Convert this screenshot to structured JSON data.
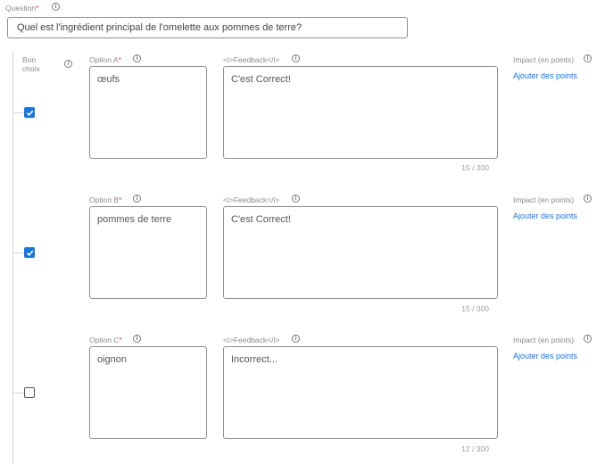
{
  "question": {
    "label": "Question",
    "required_mark": "*",
    "value": "Quel est l'ingrédient principal de l'omelette aux pommes de terre?"
  },
  "good_choice_label_line1": "Bon",
  "good_choice_label_line2": "choix",
  "options": [
    {
      "label": "Option A",
      "required_mark": "*",
      "value": "œufs",
      "checked": true,
      "feedback_label": "<i>Feedback</i>",
      "feedback": "C'est Correct!",
      "count": "15 / 300",
      "impact_label": "Impact (en points)",
      "add_points": "Ajouter des points"
    },
    {
      "label": "Option B",
      "required_mark": "*",
      "value": "pommes de terre",
      "checked": true,
      "feedback_label": "<i>Feedback</i>",
      "feedback": "C'est Correct!",
      "count": "15 / 300",
      "impact_label": "Impact (en points)",
      "add_points": "Ajouter des points"
    },
    {
      "label": "Option C",
      "required_mark": "*",
      "value": "oignon",
      "checked": false,
      "feedback_label": "<i>Feedback</i>",
      "feedback": "Incorrect...",
      "count": "12 / 300",
      "impact_label": "Impact (en points)",
      "add_points": "Ajouter des points"
    }
  ],
  "colors": {
    "accent": "#1677e0",
    "required": "#e5484d",
    "border": "#8f8f8f"
  },
  "icons": {
    "info": "info-icon",
    "check": "check-icon"
  }
}
